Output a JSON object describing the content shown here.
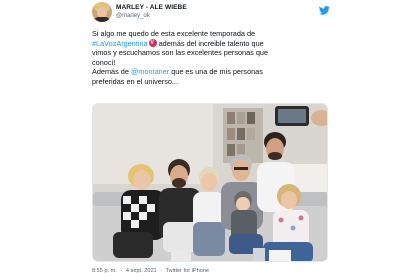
{
  "tweet": {
    "display_name": "MARLEY - ALE WIEBE",
    "handle": "@marley_ok",
    "text_line1": "Si algo me quedo de esta excelente temporada de",
    "hashtag": "#LaVozArgentina",
    "text_line2_rest": " además del increible talento que",
    "text_line3": "vimos y escuchamos son las excelentes personas que",
    "text_line4": "conocí!",
    "text_line5_pre": "Además de ",
    "mention": "@montaner",
    "text_line5_post": " que es una de mis personas",
    "text_line6": "preferidas en el universo...",
    "time": "8:55 p. m.",
    "separator": "·",
    "date": "4 sept. 2021",
    "source": "Twitter for iPhone"
  },
  "icons": {
    "brand": "twitter-bird-icon",
    "emoji": "voz-heart-emoji-icon"
  },
  "colors": {
    "link": "#1d9bf0",
    "text": "#0f1419",
    "secondary": "#536471",
    "twitter_blue": "#1d9bf0"
  }
}
